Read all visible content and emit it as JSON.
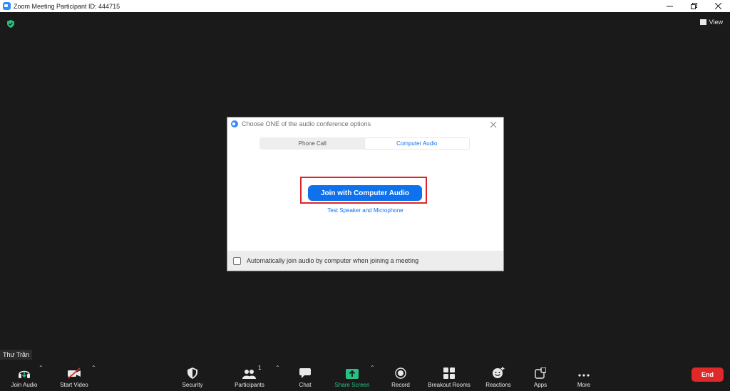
{
  "window": {
    "title": "Zoom Meeting Participant ID: 444715"
  },
  "meeting": {
    "view_label": "View"
  },
  "dialog": {
    "title": "Choose ONE of the audio conference options",
    "tabs": [
      {
        "label": "Phone Call",
        "active": false
      },
      {
        "label": "Computer Audio",
        "active": true
      }
    ],
    "join_button": "Join with Computer Audio",
    "test_link": "Test Speaker and Microphone",
    "auto_join_label": "Automatically join audio by computer when joining a meeting"
  },
  "participant": {
    "name": "Thư Trần"
  },
  "toolbar": {
    "join_audio": "Join Audio",
    "start_video": "Start Video",
    "security": "Security",
    "participants": "Participants",
    "participants_count": "1",
    "chat": "Chat",
    "share_screen": "Share Screen",
    "record": "Record",
    "breakout_rooms": "Breakout Rooms",
    "reactions": "Reactions",
    "apps": "Apps",
    "more": "More",
    "end": "End"
  },
  "colors": {
    "accent": "#0e72ed",
    "highlight": "#e0232a",
    "share_green": "#26c281",
    "end_red": "#e02828",
    "background": "#1a1a1a"
  }
}
